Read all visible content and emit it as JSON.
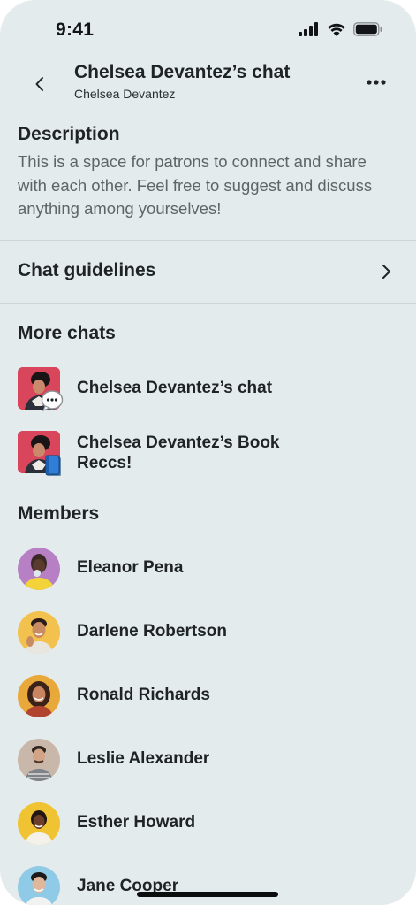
{
  "status_bar": {
    "time": "9:41"
  },
  "header": {
    "title": "Chelsea Devantez’s chat",
    "subtitle": "Chelsea Devantez",
    "back_icon": "chevron-left-icon",
    "more_icon": "ellipsis-icon"
  },
  "description": {
    "heading": "Description",
    "text": "This is a space for patrons to connect and share with each other. Feel free to suggest and discuss anything among yourselves!"
  },
  "guidelines": {
    "label": "Chat guidelines",
    "icon": "chevron-right-icon"
  },
  "more_chats": {
    "heading": "More chats",
    "items": [
      {
        "name": "Chelsea Devantez’s chat",
        "badge_icon": "chat-bubble-icon"
      },
      {
        "name": "Chelsea Devantez’s Book Reccs!",
        "badge_icon": "book-icon"
      }
    ]
  },
  "members": {
    "heading": "Members",
    "items": [
      {
        "name": "Eleanor Pena",
        "avatar_color": "#b77fc4"
      },
      {
        "name": "Darlene Robertson",
        "avatar_color": "#f2c14e"
      },
      {
        "name": "Ronald Richards",
        "avatar_color": "#e8a93a"
      },
      {
        "name": "Leslie Alexander",
        "avatar_color": "#c9b8aa"
      },
      {
        "name": "Esther Howard",
        "avatar_color": "#f0c332"
      },
      {
        "name": "Jane Cooper",
        "avatar_color": "#8fcbe6"
      }
    ]
  },
  "colors": {
    "background": "#e4ebec",
    "text_primary": "#1f2326",
    "text_secondary": "#5e6468",
    "divider": "#ccd4d6",
    "chat_thumb": "#d9455a"
  }
}
